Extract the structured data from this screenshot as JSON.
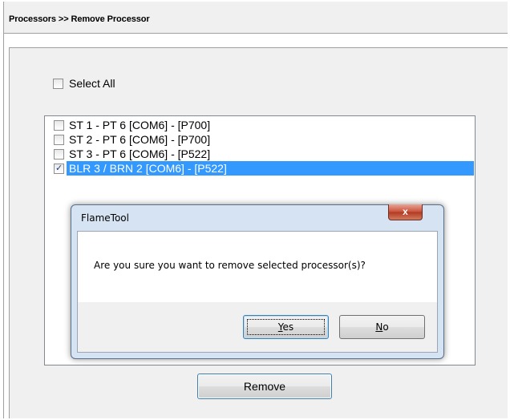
{
  "page": {
    "title": "Processors >> Remove Processor"
  },
  "select_all": {
    "label": "Select All",
    "checked": false
  },
  "processors": [
    {
      "label": "ST 1 - PT 6 [COM6] - [P700]",
      "checked": false,
      "selected": false
    },
    {
      "label": "ST 2 - PT 6 [COM6] - [P700]",
      "checked": false,
      "selected": false
    },
    {
      "label": "ST 3 - PT 6 [COM6] - [P522]",
      "checked": false,
      "selected": false
    },
    {
      "label": "BLR 3 / BRN 2 [COM6] - [P522]",
      "checked": true,
      "selected": true
    }
  ],
  "remove_button": {
    "label": "Remove"
  },
  "dialog": {
    "title": "FlameTool",
    "close_glyph": "x",
    "message": "Are you sure you want to remove selected processor(s)?",
    "yes_accel": "Y",
    "yes_rest": "es",
    "no_accel": "N",
    "no_rest": "o"
  },
  "icons": {
    "check": "✓"
  },
  "colors": {
    "selection": "#3399ff",
    "panel_bg": "#f0f0f0"
  }
}
